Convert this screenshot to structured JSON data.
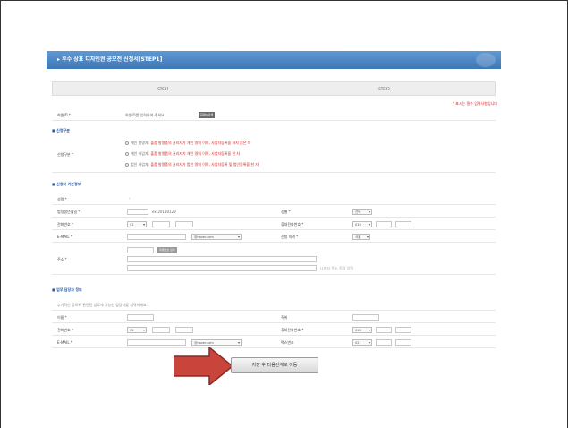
{
  "form": {
    "title": "▸ 우수 상표 디자인권 공모전 신청서[STEP1]",
    "steps": [
      "STEP1",
      "STEP2"
    ],
    "required_note": "* 표시는 필수 입력사항입니다",
    "registration": {
      "label": "회원ID *",
      "hint": "회원ID를 입력하여 주세요",
      "button": "회원ID검색"
    },
    "applicant_type": {
      "section": "■ 신청구분",
      "label": "신청구분 *",
      "options": [
        {
          "prefix": "개인 발명자:",
          "text": "출품 발명품의 권리자가 개인 명의 이며, 사업자등록을 하지 않은 자"
        },
        {
          "prefix": "개인 사업자:",
          "text": "출품 발명품의 권리자가 개인 명의 이며, 사업자등록을 한 자"
        },
        {
          "prefix": "법인 사업자:",
          "text": "출품 발명품의 권리자가 법인 명의 이며, 사업자등록 및 법인등록을 한 자"
        }
      ]
    },
    "basic_info": {
      "section": "■ 신청자 기본정보",
      "name": "성명 *",
      "birth": "법정생년월일 *",
      "birth_hint": "ex)20130129",
      "gender": "성별 *",
      "gender_value": "선택",
      "phone": "전화번호 *",
      "phone_prefix": "02",
      "mobile": "휴대전화번호 *",
      "mobile_prefix": "010",
      "email": "E-MAIL *",
      "email_domain": "@naver.com",
      "region": "신청 지역 *",
      "region_value": "서울",
      "address": "주소 *",
      "zip_button": "우편번호 검색",
      "address_hint": "나머지 주소 직접 입력"
    },
    "contact_info": {
      "section": "■ 업무 담당자 정보",
      "note": "추가적인 공모와 관련된 업무에 가능한 담당자를 입력하세요.",
      "name": "이름 *",
      "position": "직위",
      "phone": "전화번호 *",
      "phone_prefix": "02",
      "mobile": "휴대전화번호 *",
      "mobile_prefix": "010",
      "email": "E-MAIL *",
      "email_domain": "@naver.com",
      "fax": "팩스번호",
      "fax_prefix": "02"
    },
    "save_button": "저장 후 다음단계로 이동"
  }
}
